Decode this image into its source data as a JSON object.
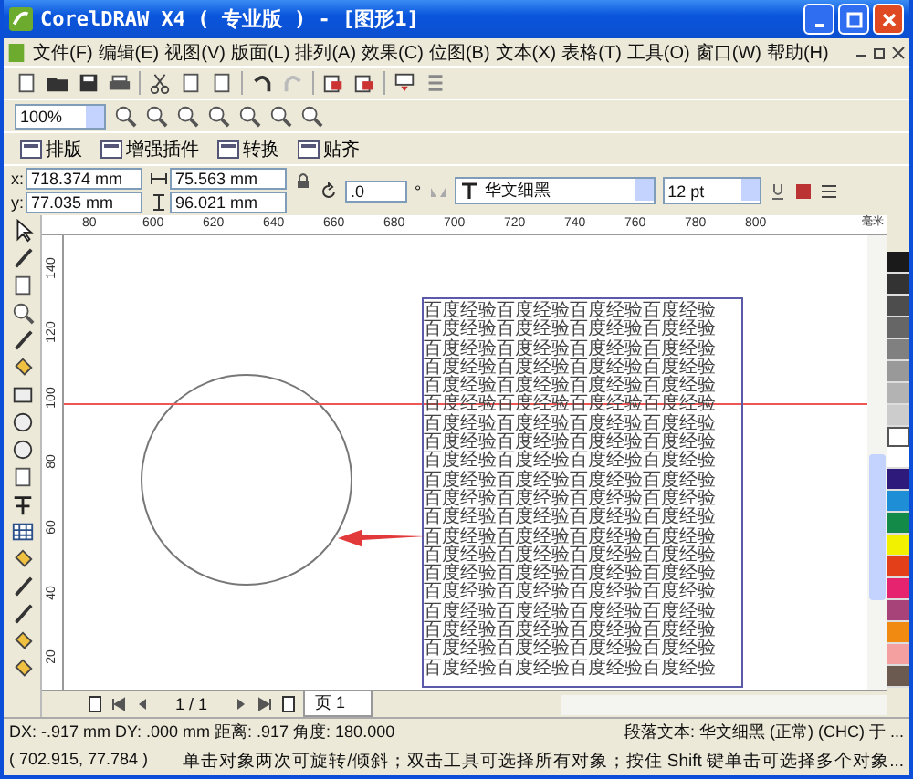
{
  "window": {
    "title": "CorelDRAW X4 ( 专业版 ) - [图形1]"
  },
  "menu": [
    "文件(F)",
    "编辑(E)",
    "视图(V)",
    "版面(L)",
    "排列(A)",
    "效果(C)",
    "位图(B)",
    "文本(X)",
    "表格(T)",
    "工具(O)",
    "窗口(W)",
    "帮助(H)"
  ],
  "zoom": {
    "value": "100%"
  },
  "plugin_toolbar": [
    "排版",
    "增强插件",
    "转换",
    "贴齐"
  ],
  "properties": {
    "x_label": "x:",
    "x": "718.374 mm",
    "y_label": "y:",
    "y": "77.035 mm",
    "width": "75.563 mm",
    "height": "96.021 mm",
    "rotation": ".0",
    "degree": "°",
    "font": "华文细黑",
    "size": "12 pt"
  },
  "ruler": {
    "horizontal": [
      "80",
      "600",
      "620",
      "640",
      "660",
      "680",
      "700",
      "720",
      "740",
      "760",
      "780",
      "800"
    ],
    "unit": "毫米",
    "vertical": [
      "140",
      "120",
      "100",
      "80",
      "60",
      "40",
      "20"
    ]
  },
  "canvas": {
    "text_frame": {
      "lines": [
        "百度经验百度经验百度经验百度经验",
        "百度经验百度经验百度经验百度经验",
        "百度经验百度经验百度经验百度经验",
        "百度经验百度经验百度经验百度经验",
        "百度经验百度经验百度经验百度经验",
        "百度经验百度经验百度经验百度经验",
        "百度经验百度经验百度经验百度经验",
        "百度经验百度经验百度经验百度经验",
        "百度经验百度经验百度经验百度经验",
        "百度经验百度经验百度经验百度经验",
        "百度经验百度经验百度经验百度经验",
        "百度经验百度经验百度经验百度经验",
        "百度经验百度经验百度经验百度经验",
        "百度经验百度经验百度经验百度经验",
        "百度经验百度经验百度经验百度经验",
        "百度经验百度经验百度经验百度经验",
        "百度经验百度经验百度经验百度经验",
        "百度经验百度经验百度经验百度经验",
        "百度经验百度经验百度经验百度经验",
        "百度经验百度经验百度经验百度经验"
      ]
    }
  },
  "palette": [
    {
      "kind": "swatch",
      "color": "#1a1a1a"
    },
    {
      "kind": "swatch",
      "color": "#333333"
    },
    {
      "kind": "swatch",
      "color": "#4d4d4d"
    },
    {
      "kind": "swatch",
      "color": "#666666"
    },
    {
      "kind": "swatch",
      "color": "#808080"
    },
    {
      "kind": "swatch",
      "color": "#999999"
    },
    {
      "kind": "swatch",
      "color": "#b3b3b3"
    },
    {
      "kind": "swatch",
      "color": "#cccccc"
    },
    {
      "kind": "none"
    },
    {
      "kind": "swatch",
      "color": "#ffffff"
    },
    {
      "kind": "swatch",
      "color": "#2e1a7a"
    },
    {
      "kind": "swatch",
      "color": "#1e8fd6"
    },
    {
      "kind": "swatch",
      "color": "#138a48"
    },
    {
      "kind": "swatch",
      "color": "#f2f200"
    },
    {
      "kind": "swatch",
      "color": "#e3401a"
    },
    {
      "kind": "swatch",
      "color": "#e6236e"
    },
    {
      "kind": "swatch",
      "color": "#a8437a"
    },
    {
      "kind": "swatch",
      "color": "#f08a10"
    },
    {
      "kind": "swatch",
      "color": "#f5a0a0"
    },
    {
      "kind": "swatch",
      "color": "#6b5a50"
    }
  ],
  "page_nav": {
    "counter": "1 / 1",
    "tabs": [
      {
        "label": "页 1",
        "selected": true
      }
    ]
  },
  "status_bar": {
    "line_1_left": "DX: -.917 mm DY: .000 mm 距离: .917 角度: 180.000",
    "line_1_right": "段落文本: 华文细黑 (正常) (CHC) 于 ...",
    "line_2_left": "( 702.915, 77.784 )",
    "line_2_right": "单击对象两次可旋转/倾斜；双击工具可选择所有对象；按住 Shift 键单击可选择多个对象..."
  }
}
